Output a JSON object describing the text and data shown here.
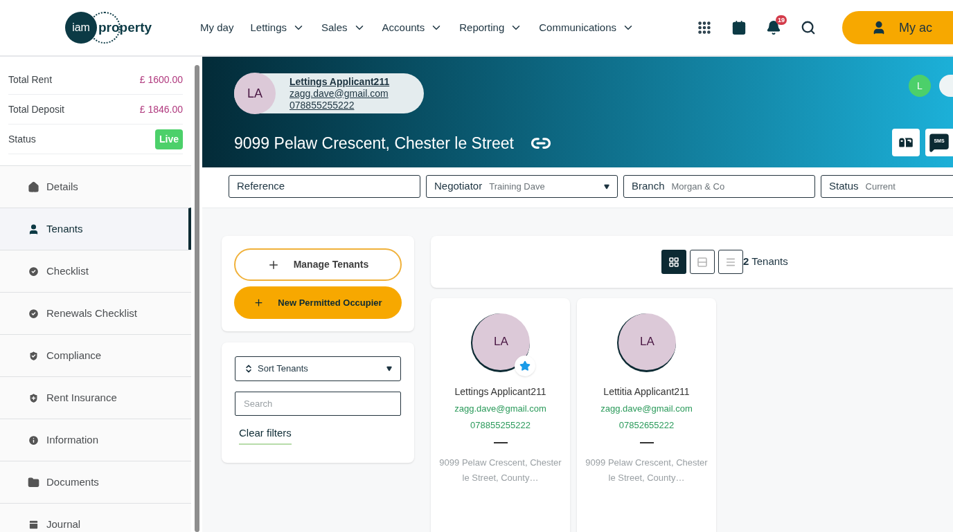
{
  "logo": {
    "mark": "iam",
    "word": "property"
  },
  "nav": {
    "items": [
      {
        "label": "My day",
        "dropdown": false
      },
      {
        "label": "Lettings",
        "dropdown": true
      },
      {
        "label": "Sales",
        "dropdown": true
      },
      {
        "label": "Accounts",
        "dropdown": true
      },
      {
        "label": "Reporting",
        "dropdown": true
      },
      {
        "label": "Communications",
        "dropdown": true
      }
    ],
    "notifications": "19",
    "account": "My ac"
  },
  "summary": [
    {
      "label": "Total Rent",
      "value": "£ 1600.00",
      "kind": "amount"
    },
    {
      "label": "Total Deposit",
      "value": "£ 1846.00",
      "kind": "amount"
    },
    {
      "label": "Status",
      "value": "Live",
      "kind": "badge"
    }
  ],
  "sidebar": {
    "items": [
      {
        "label": "Details",
        "selected": false
      },
      {
        "label": "Tenants",
        "selected": true
      },
      {
        "label": "Checklist",
        "selected": false
      },
      {
        "label": "Renewals Checklist",
        "selected": false
      },
      {
        "label": "Compliance",
        "selected": false
      },
      {
        "label": "Rent Insurance",
        "selected": false
      },
      {
        "label": "Information",
        "selected": false
      },
      {
        "label": "Documents",
        "selected": false
      },
      {
        "label": "Journal",
        "selected": false
      }
    ]
  },
  "header": {
    "contact": {
      "initials": "LA",
      "name": "Lettings Applicant211",
      "email": "zagg.dave@gmail.com",
      "phone": "078855255222"
    },
    "address": "9099 Pelaw Crescent, Chester le Street",
    "user_initial": "L",
    "sms": "SMS"
  },
  "fields": [
    {
      "label": "Reference",
      "kind": "text"
    },
    {
      "label": "Negotiator",
      "value": "Training Dave",
      "kind": "select"
    },
    {
      "label": "Branch",
      "value": "Morgan & Co",
      "kind": "text"
    },
    {
      "label": "Status",
      "value": "Current",
      "kind": "text"
    }
  ],
  "actions": [
    {
      "label": "Manage Tenants",
      "kind": "outline"
    },
    {
      "label": "New Permitted Occupier",
      "kind": "filled"
    }
  ],
  "filters": {
    "sort": "Sort Tenants",
    "search_placeholder": "Search",
    "clear": "Clear filters"
  },
  "view_modes": [
    {
      "selected": true
    },
    {
      "selected": false
    },
    {
      "selected": false
    }
  ],
  "count": "**2** Tenants",
  "tenants": [
    {
      "initials": "LA",
      "name": "Lettings Applicant211",
      "email": "zagg.dave@gmail.com",
      "phone": "078855255222",
      "address": "9099 Pelaw Crescent, Chester le Street, County…",
      "lead": true
    },
    {
      "initials": "LA",
      "name": "Lettitia Applicant211",
      "email": "zagg.dave@gmail.com",
      "phone": "07852655222",
      "address": "9099 Pelaw Crescent, Chester le Street, County…",
      "lead": false
    }
  ]
}
